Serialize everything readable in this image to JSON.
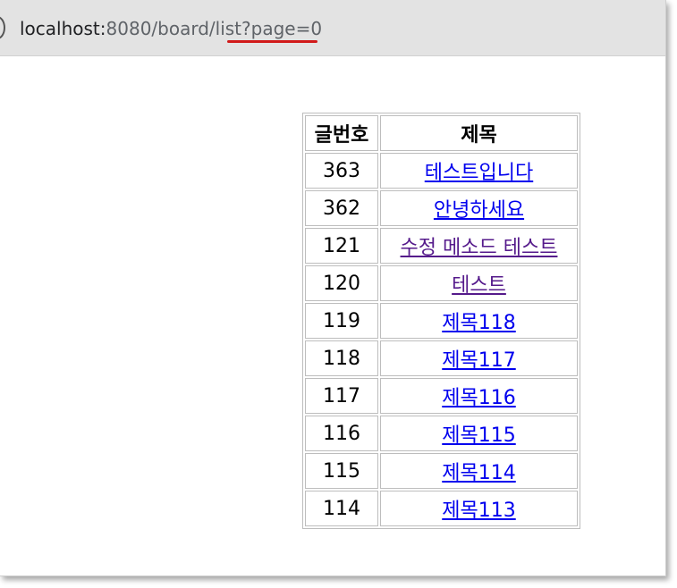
{
  "browser": {
    "url_host": "localhost:",
    "url_path": "8080/board/list?page=0",
    "highlight_color": "#d11a1a"
  },
  "board": {
    "headers": {
      "number": "글번호",
      "title": "제목"
    },
    "rows": [
      {
        "number": "363",
        "title": "테스트입니다",
        "visited": false
      },
      {
        "number": "362",
        "title": "안녕하세요",
        "visited": false
      },
      {
        "number": "121",
        "title": "수정 메소드 테스트",
        "visited": true
      },
      {
        "number": "120",
        "title": "테스트",
        "visited": true
      },
      {
        "number": "119",
        "title": "제목118",
        "visited": false
      },
      {
        "number": "118",
        "title": "제목117",
        "visited": false
      },
      {
        "number": "117",
        "title": "제목116",
        "visited": false
      },
      {
        "number": "116",
        "title": "제목115",
        "visited": false
      },
      {
        "number": "115",
        "title": "제목114",
        "visited": false
      },
      {
        "number": "114",
        "title": "제목113",
        "visited": false
      }
    ]
  }
}
